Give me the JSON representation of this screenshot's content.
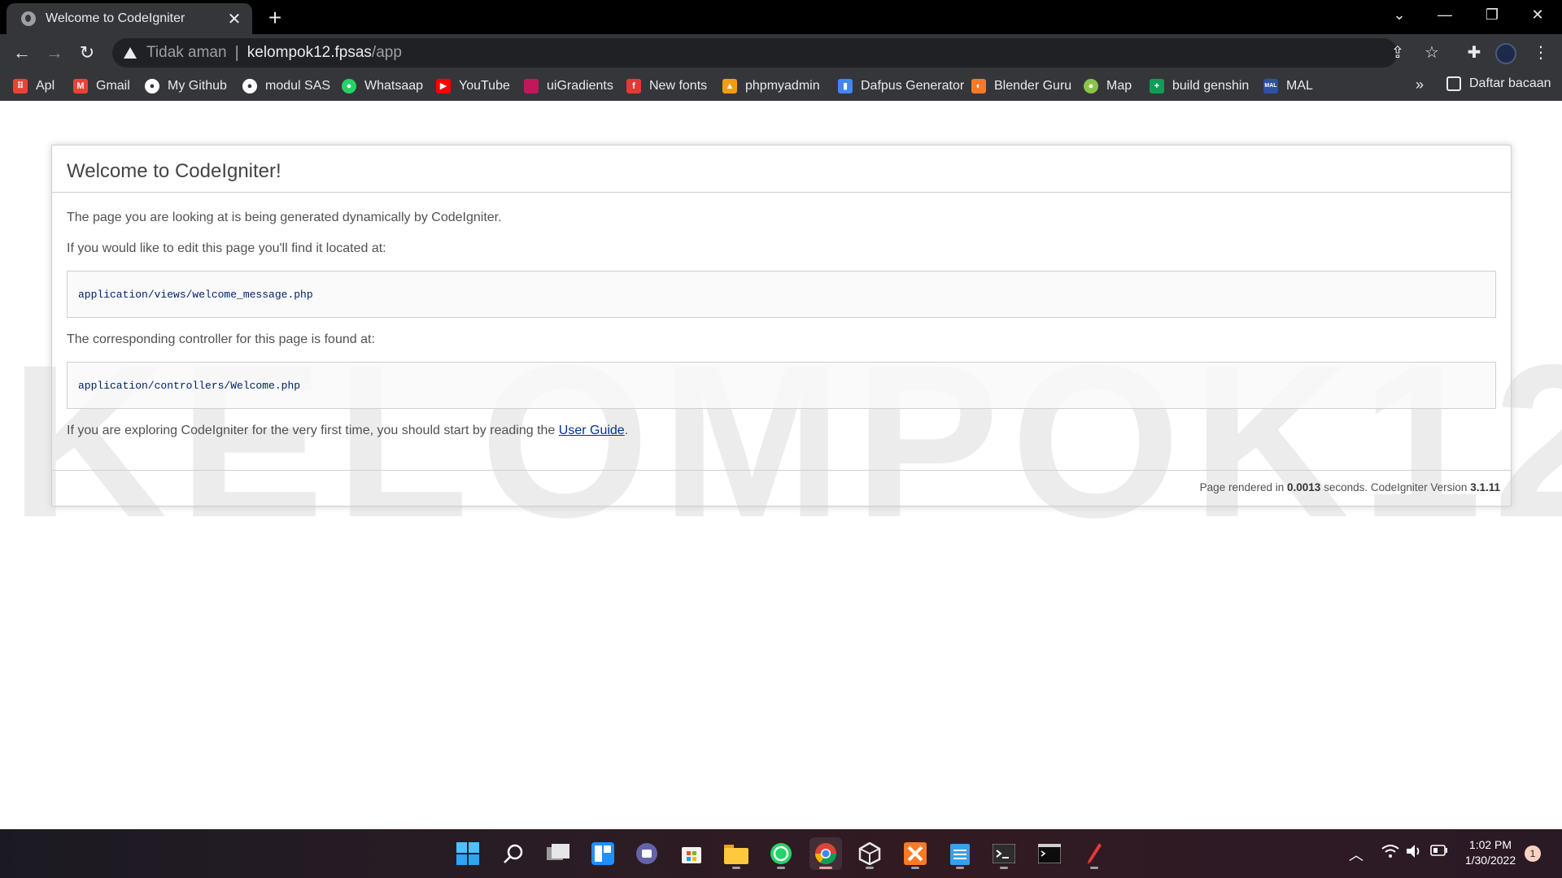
{
  "browser": {
    "tab_title": "Welcome to CodeIgniter",
    "address": {
      "security_label": "Tidak aman",
      "host": "kelompok12.fpsas",
      "path": "/app"
    },
    "bookmarks": [
      {
        "label": "Apl",
        "icon": "apps-grid-icon",
        "color": "#ea4335"
      },
      {
        "label": "Gmail",
        "icon": "gmail-icon",
        "color": "#ea4335"
      },
      {
        "label": "My Github",
        "icon": "github-icon",
        "color": "#ffffff"
      },
      {
        "label": "modul SAS",
        "icon": "github-icon",
        "color": "#ffffff"
      },
      {
        "label": "Whatsaap",
        "icon": "whatsapp-icon",
        "color": "#25d366"
      },
      {
        "label": "YouTube",
        "icon": "youtube-icon",
        "color": "#ff0000"
      },
      {
        "label": "uiGradients",
        "icon": "uigradients-icon",
        "color": "#c2185b"
      },
      {
        "label": "New fonts",
        "icon": "fonts-icon",
        "color": "#e53935"
      },
      {
        "label": "phpmyadmin",
        "icon": "phpmyadmin-icon",
        "color": "#f39c12"
      },
      {
        "label": "Dafpus Generator",
        "icon": "bookmark-icon",
        "color": "#4285f4"
      },
      {
        "label": "Blender Guru",
        "icon": "blender-icon",
        "color": "#f5792a"
      },
      {
        "label": "Map",
        "icon": "globe-icon",
        "color": "#8bc34a"
      },
      {
        "label": "build genshin",
        "icon": "sheets-icon",
        "color": "#0f9d58"
      },
      {
        "label": "MAL",
        "icon": "mal-icon",
        "color": "#2e51a2"
      }
    ],
    "bookmarks_more": "»",
    "reading_list": "Daftar bacaan"
  },
  "page": {
    "heading": "Welcome to CodeIgniter!",
    "intro": "The page you are looking at is being generated dynamically by CodeIgniter.",
    "edit_text": "If you would like to edit this page you'll find it located at:",
    "view_path": "application/views/welcome_message.php",
    "controller_text": "The corresponding controller for this page is found at:",
    "controller_path": "application/controllers/Welcome.php",
    "explore_text": "If you are exploring CodeIgniter for the very first time, you should start by reading the",
    "user_guide_link": "User Guide",
    "period": ".",
    "footer": {
      "prefix": "Page rendered in",
      "seconds": "0.0013",
      "middle": "seconds. CodeIgniter Version",
      "version": "3.1.11"
    },
    "watermark": "KELOMPOK12"
  },
  "taskbar": {
    "time": "1:02 PM",
    "date": "1/30/2022",
    "notifications": "1"
  }
}
